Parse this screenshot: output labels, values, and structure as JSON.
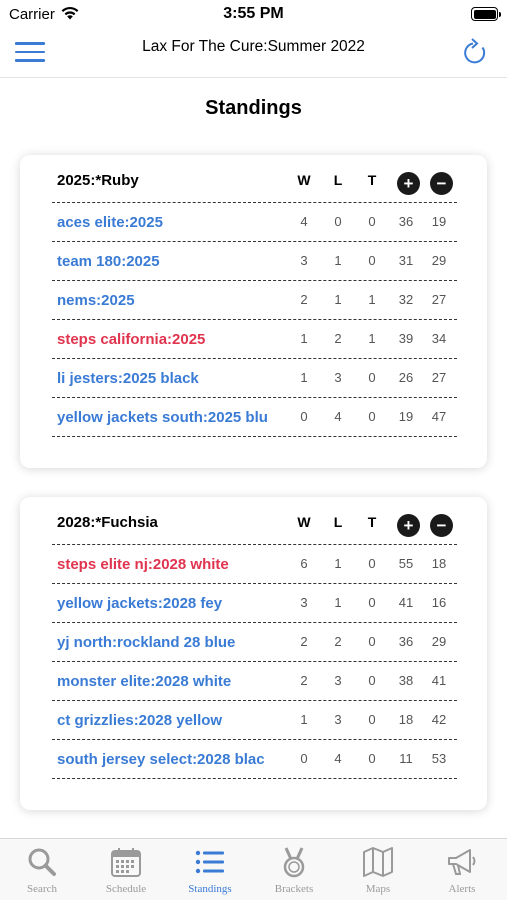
{
  "status_bar": {
    "carrier": "Carrier",
    "time": "3:55 PM"
  },
  "nav": {
    "title": "Lax For The Cure:Summer 2022"
  },
  "page_title": "Standings",
  "columns": {
    "w": "W",
    "l": "L",
    "t": "T",
    "plus": "+",
    "minus": "−"
  },
  "divisions": [
    {
      "name": "2025:*Ruby",
      "teams": [
        {
          "name": "aces elite:2025",
          "w": "4",
          "l": "0",
          "t": "0",
          "pf": "36",
          "pa": "19"
        },
        {
          "name": "team 180:2025",
          "w": "3",
          "l": "1",
          "t": "0",
          "pf": "31",
          "pa": "29"
        },
        {
          "name": "nems:2025",
          "w": "2",
          "l": "1",
          "t": "1",
          "pf": "32",
          "pa": "27"
        },
        {
          "name": "steps california:2025",
          "w": "1",
          "l": "2",
          "t": "1",
          "pf": "39",
          "pa": "34"
        },
        {
          "name": "li jesters:2025 black",
          "w": "1",
          "l": "3",
          "t": "0",
          "pf": "26",
          "pa": "27"
        },
        {
          "name": "yellow jackets south:2025 blu",
          "w": "0",
          "l": "4",
          "t": "0",
          "pf": "19",
          "pa": "47"
        }
      ]
    },
    {
      "name": "2028:*Fuchsia",
      "teams": [
        {
          "name": "steps elite nj:2028 white",
          "w": "6",
          "l": "1",
          "t": "0",
          "pf": "55",
          "pa": "18"
        },
        {
          "name": "yellow jackets:2028 fey",
          "w": "3",
          "l": "1",
          "t": "0",
          "pf": "41",
          "pa": "16"
        },
        {
          "name": "yj north:rockland 28 blue",
          "w": "2",
          "l": "2",
          "t": "0",
          "pf": "36",
          "pa": "29"
        },
        {
          "name": "monster elite:2028 white",
          "w": "2",
          "l": "3",
          "t": "0",
          "pf": "38",
          "pa": "41"
        },
        {
          "name": "ct grizzlies:2028 yellow",
          "w": "1",
          "l": "3",
          "t": "0",
          "pf": "18",
          "pa": "42"
        },
        {
          "name": "south jersey select:2028 blac",
          "w": "0",
          "l": "4",
          "t": "0",
          "pf": "11",
          "pa": "53"
        }
      ]
    }
  ],
  "tabs": [
    {
      "label": "Search",
      "icon": "search-icon"
    },
    {
      "label": "Schedule",
      "icon": "calendar-icon"
    },
    {
      "label": "Standings",
      "icon": "list-icon"
    },
    {
      "label": "Brackets",
      "icon": "medal-icon"
    },
    {
      "label": "Maps",
      "icon": "map-icon"
    },
    {
      "label": "Alerts",
      "icon": "megaphone-icon"
    }
  ],
  "colors": {
    "accent": "#3a7bd5",
    "highlight": "#e0344f",
    "tab_inactive": "#9a9a9a"
  }
}
